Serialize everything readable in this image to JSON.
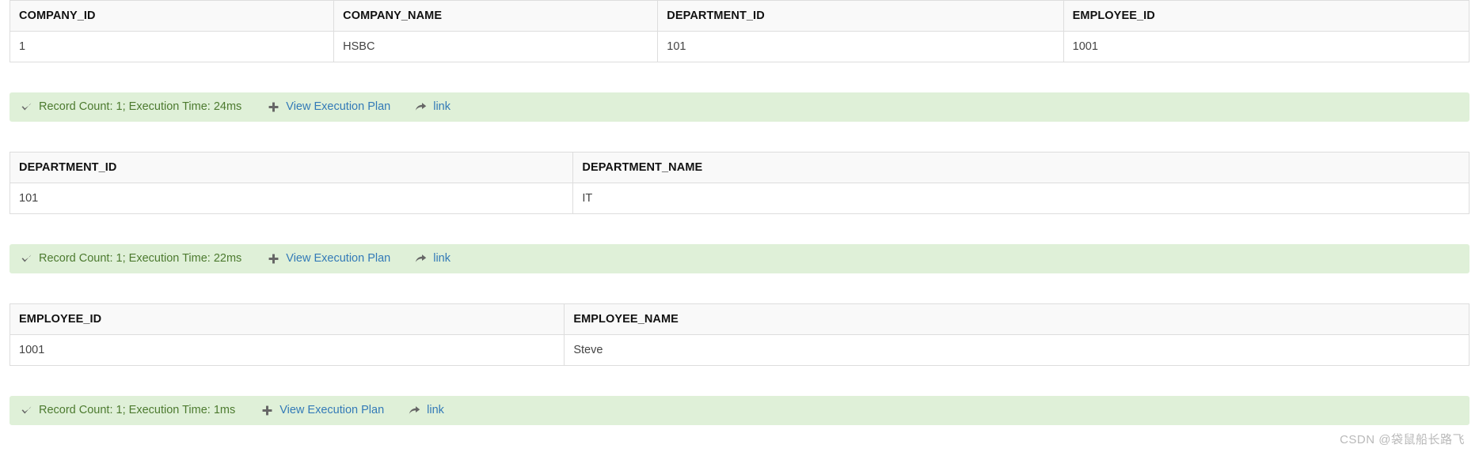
{
  "colors": {
    "status_background": "#dff0d8",
    "status_text": "#4c7a2f",
    "link": "#337ab7",
    "icon": "#666666",
    "table_border": "#dddddd",
    "header_background": "#f9f9f9",
    "cell_text": "#444444",
    "watermark": "#b9b9b9"
  },
  "results": [
    {
      "columns": [
        "COMPANY_ID",
        "COMPANY_NAME",
        "DEPARTMENT_ID",
        "EMPLOYEE_ID"
      ],
      "rows": [
        [
          "1",
          "HSBC",
          "101",
          "1001"
        ]
      ],
      "status": {
        "check_icon": "check-icon",
        "summary": "Record Count: 1; Execution Time: 24ms",
        "record_count": 1,
        "execution_time": "24ms",
        "plan_icon": "plus-icon",
        "plan_label": "View Execution Plan",
        "link_icon": "share-arrow-icon",
        "link_label": "link"
      }
    },
    {
      "columns": [
        "DEPARTMENT_ID",
        "DEPARTMENT_NAME"
      ],
      "rows": [
        [
          "101",
          "IT"
        ]
      ],
      "status": {
        "check_icon": "check-icon",
        "summary": "Record Count: 1; Execution Time: 22ms",
        "record_count": 1,
        "execution_time": "22ms",
        "plan_icon": "plus-icon",
        "plan_label": "View Execution Plan",
        "link_icon": "share-arrow-icon",
        "link_label": "link"
      }
    },
    {
      "columns": [
        "EMPLOYEE_ID",
        "EMPLOYEE_NAME"
      ],
      "rows": [
        [
          "1001",
          "Steve"
        ]
      ],
      "status": {
        "check_icon": "check-icon",
        "summary": "Record Count: 1; Execution Time: 1ms",
        "record_count": 1,
        "execution_time": "1ms",
        "plan_icon": "plus-icon",
        "plan_label": "View Execution Plan",
        "link_icon": "share-arrow-icon",
        "link_label": "link"
      }
    }
  ],
  "watermark": "CSDN @袋鼠船长路飞"
}
